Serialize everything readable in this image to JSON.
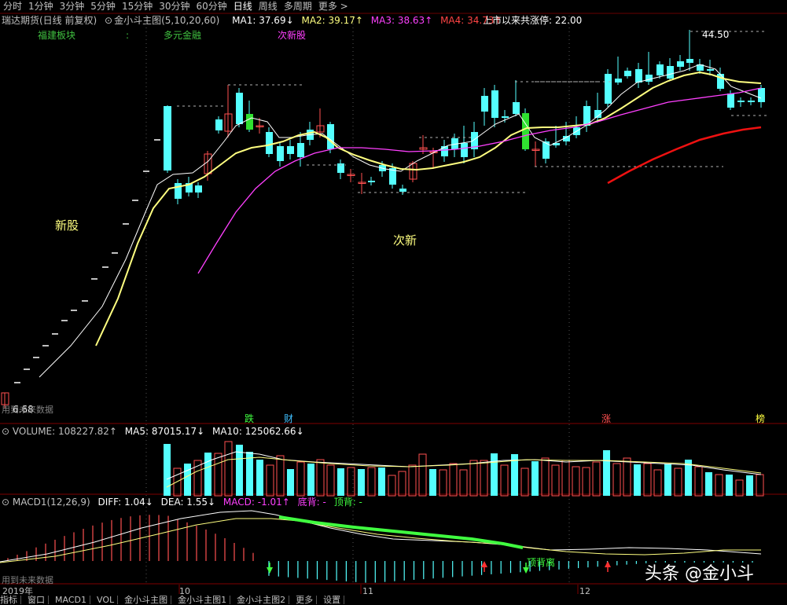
{
  "topbar": {
    "tabs": [
      "分时",
      "1分钟",
      "3分钟",
      "5分钟",
      "15分钟",
      "30分钟",
      "60分钟",
      "日线",
      "周线",
      "多周期",
      "更多 >"
    ],
    "active": 7
  },
  "infobar": {
    "title": "瑞达期货(日线 前复权)",
    "indicator": "金小斗主图(5,10,20,60)",
    "ma1": "MA1: 37.69↓",
    "ma2": "MA2: 39.17↑",
    "ma3": "MA3: 38.63↑",
    "ma4": "MA4: 34.73↑",
    "limit_up": "上市以来共涨停: 22.00"
  },
  "subbar": {
    "a": "福建板块",
    "b": "多元金融",
    "c": "次新股"
  },
  "annotations": {
    "new_stock": "新股",
    "sub_new": "次新",
    "high": "44.50",
    "low": "6.68",
    "future_left": "用到未来数据"
  },
  "markers": {
    "die": "跌",
    "cai": "财",
    "zhang": "涨",
    "bang": "榜"
  },
  "volume_bar": {
    "v": "VOLUME: 108227.82↑",
    "ma5": "MA5: 87015.17↓",
    "ma10": "MA10: 125062.66↓"
  },
  "macd_bar": {
    "m": "MACD1(12,26,9)",
    "diff": "DIFF: 1.04↓",
    "dea": "DEA: 1.55↓",
    "macd": "MACD: -1.01↑",
    "di": "底背: -",
    "ding": "顶背: -"
  },
  "macd_annot": {
    "ding_li": "顶背离",
    "future": "用到未来数据"
  },
  "dates": {
    "y": "2019年",
    "m10": "10",
    "m11": "11",
    "m12": "12"
  },
  "watermark": "头条 @金小斗",
  "bottombar": [
    "指标",
    "窗口",
    "MACD1",
    "VOL",
    "金小斗主图",
    "金小斗主图1",
    "金小斗主图2",
    "更多",
    "设置"
  ],
  "colors": {
    "up": "#ff5050",
    "down": "#54ffff",
    "ma1": "#ffffff",
    "ma2": "#ffff80",
    "ma3": "#ff40ff",
    "ma4": "#ee1111"
  }
}
